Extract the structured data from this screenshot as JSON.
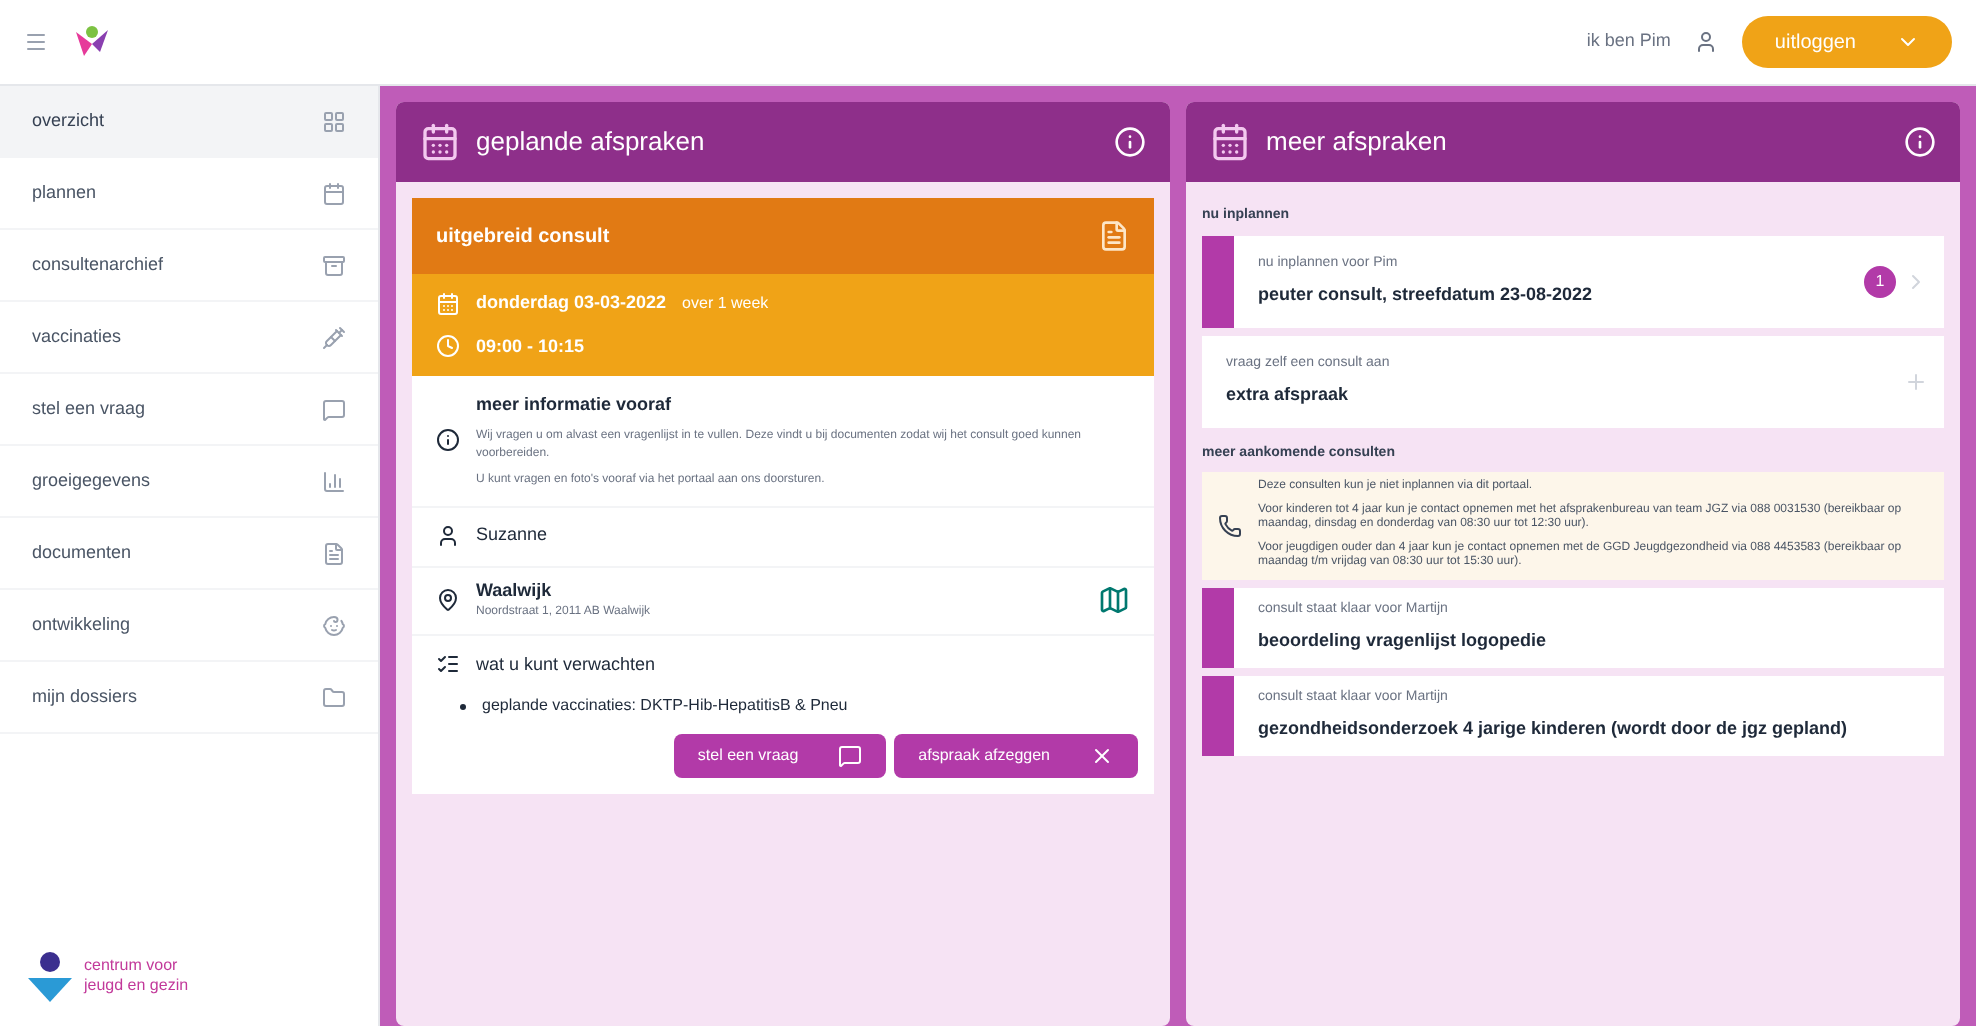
{
  "header": {
    "user": "ik ben Pim",
    "logout": "uitloggen"
  },
  "sidebar": {
    "items": [
      {
        "label": "overzicht",
        "selected": true
      },
      {
        "label": "plannen",
        "selected": false
      },
      {
        "label": "consultenarchief",
        "selected": false
      },
      {
        "label": "vaccinaties",
        "selected": false
      },
      {
        "label": "stel een vraag",
        "selected": false
      },
      {
        "label": "groeigegevens",
        "selected": false
      },
      {
        "label": "documenten",
        "selected": false
      },
      {
        "label": "ontwikkeling",
        "selected": false
      },
      {
        "label": "mijn dossiers",
        "selected": false
      }
    ],
    "logo_text": [
      "centrum voor",
      "jeugd en gezin"
    ]
  },
  "planned": {
    "title": "geplande afspraken",
    "appointment": {
      "type": "uitgebreid consult",
      "date": "donderdag 03-03-2022",
      "relative": "over 1 week",
      "time": "09:00 - 10:15",
      "info_title": "meer informatie vooraf",
      "info_text": "Wij vragen u om alvast een vragenlijst in te vullen. Deze vindt u bij documenten zodat wij het consult goed kunnen voorbereiden.",
      "info_note": "U kunt vragen en foto's vooraf via het portaal aan ons doorsturen.",
      "person": "Suzanne",
      "location": "Waalwijk",
      "address": "Noordstraat 1, 2011 AB Waalwijk",
      "expect_title": "wat u kunt verwachten",
      "expect_items": [
        "geplande vaccinaties: DKTP-Hib-HepatitisB & Pneu"
      ],
      "buttons": [
        "stel een vraag",
        "afspraak afzeggen"
      ]
    }
  },
  "more": {
    "title": "meer afspraken",
    "plan_heading": "nu inplannen",
    "plan_items": [
      {
        "kind": "accent",
        "caption": "nu inplannen voor Pim",
        "title": "peuter consult, streefdatum 23-08-2022",
        "badge": "1"
      },
      {
        "kind": "plain",
        "caption": "vraag zelf een consult aan",
        "title": "extra afspraak"
      }
    ],
    "upcoming_heading": "meer aankomende consulten",
    "notice": [
      "Deze consulten kun je niet inplannen via dit portaal.",
      "Voor kinderen tot 4 jaar kun je contact opnemen met het afsprakenbureau van team JGZ via 088 0031530 (bereikbaar op maandag, dinsdag en donderdag van 08:30 uur tot 12:30 uur).",
      "Voor jeugdigen ouder dan 4 jaar kun je contact opnemen met de GGD Jeugdgezondheid via 088 4453583 (bereikbaar op maandag t/m vrijdag van 08:30 uur tot 15:30 uur)."
    ],
    "upcoming": [
      {
        "caption": "consult staat klaar voor Martijn",
        "title": "beoordeling vragenlijst logopedie"
      },
      {
        "caption": "consult staat klaar voor Martijn",
        "title": "gezondheidsonderzoek 4 jarige kinderen (wordt door de jgz gepland)"
      }
    ]
  }
}
